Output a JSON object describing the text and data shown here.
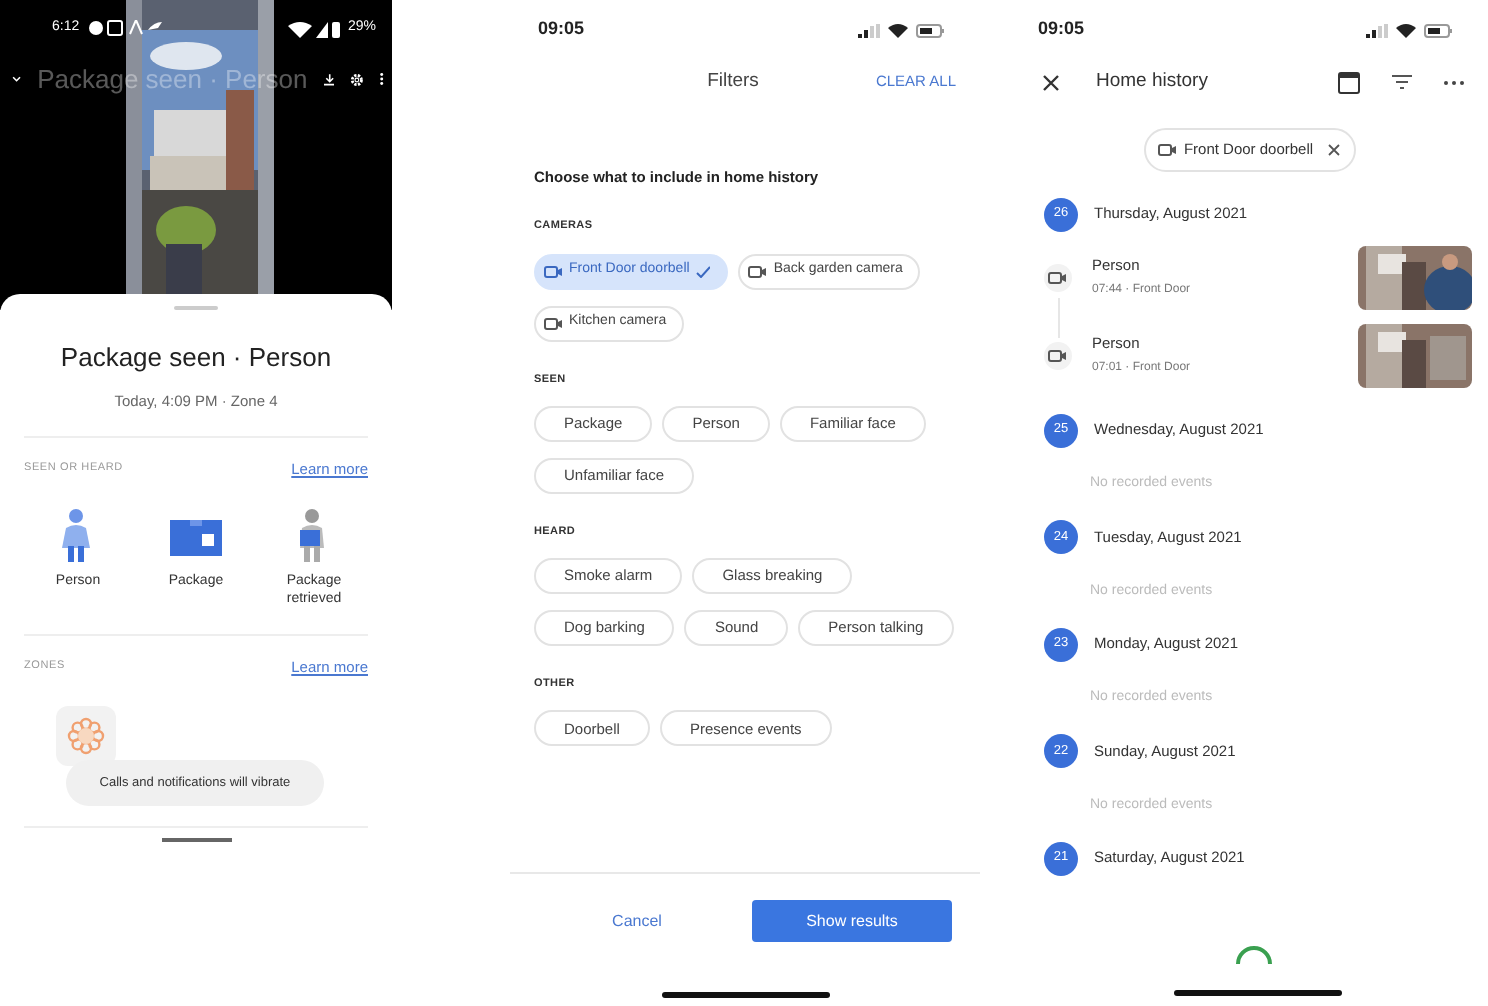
{
  "event_screen": {
    "status_bar": {
      "time": "6:12",
      "battery": "29%"
    },
    "video_title": "Package seen · Person",
    "sheet": {
      "title": "Package seen · Person",
      "subtitle": "Today, 4:09 PM · Zone 4",
      "sections": [
        {
          "heading": "SEEN OR HEARD",
          "link": "Learn more",
          "items": [
            {
              "kind": "person",
              "label": "Person"
            },
            {
              "kind": "package",
              "label": "Package"
            },
            {
              "kind": "package_retrieved",
              "label": "Package retrieved"
            }
          ]
        },
        {
          "heading": "ZONES",
          "link": "Learn more",
          "items": [
            {
              "kind": "zone"
            }
          ]
        }
      ]
    },
    "toast": "Calls and notifications will vibrate"
  },
  "filters_screen": {
    "status_bar": {
      "time": "09:05"
    },
    "title": "Filters",
    "clear_all": "CLEAR ALL",
    "prompt": "Choose what to include in home history",
    "groups": [
      {
        "heading": "CAMERAS",
        "chips": [
          {
            "kind": "camera",
            "label": "Front Door doorbell",
            "selected": true
          },
          {
            "kind": "camera",
            "label": "Back garden camera",
            "selected": false
          },
          {
            "kind": "camera",
            "label": "Kitchen camera",
            "selected": false
          }
        ]
      },
      {
        "heading": "SEEN",
        "chips": [
          {
            "kind": "plain",
            "label": "Package",
            "selected": false
          },
          {
            "kind": "plain",
            "label": "Person",
            "selected": false
          },
          {
            "kind": "plain",
            "label": "Familiar face",
            "selected": false
          },
          {
            "kind": "plain",
            "label": "Unfamiliar face",
            "selected": false
          }
        ]
      },
      {
        "heading": "HEARD",
        "chips": [
          {
            "kind": "plain",
            "label": "Smoke alarm",
            "selected": false
          },
          {
            "kind": "plain",
            "label": "Glass breaking",
            "selected": false
          },
          {
            "kind": "plain",
            "label": "Dog barking",
            "selected": false
          },
          {
            "kind": "plain",
            "label": "Sound",
            "selected": false
          },
          {
            "kind": "plain",
            "label": "Person talking",
            "selected": false
          }
        ]
      },
      {
        "heading": "OTHER",
        "chips": [
          {
            "kind": "plain",
            "label": "Doorbell",
            "selected": false
          },
          {
            "kind": "plain",
            "label": "Presence events",
            "selected": false
          }
        ]
      }
    ],
    "cancel": "Cancel",
    "submit": "Show results"
  },
  "history_screen": {
    "status_bar": {
      "time": "09:05"
    },
    "title": "Home history",
    "filter_chip": "Front Door doorbell",
    "days": [
      {
        "day": "26",
        "date": "Thursday, August 2021",
        "events": [
          {
            "title": "Person",
            "meta": "07:44 · Front Door"
          },
          {
            "title": "Person",
            "meta": "07:01 · Front Door"
          }
        ]
      },
      {
        "day": "25",
        "date": "Wednesday, August 2021",
        "empty_text": "No recorded events"
      },
      {
        "day": "24",
        "date": "Tuesday, August 2021",
        "empty_text": "No recorded events"
      },
      {
        "day": "23",
        "date": "Monday, August 2021",
        "empty_text": "No recorded events"
      },
      {
        "day": "22",
        "date": "Sunday, August 2021",
        "empty_text": "No recorded events"
      },
      {
        "day": "21",
        "date": "Saturday, August 2021"
      }
    ],
    "loading": true
  }
}
